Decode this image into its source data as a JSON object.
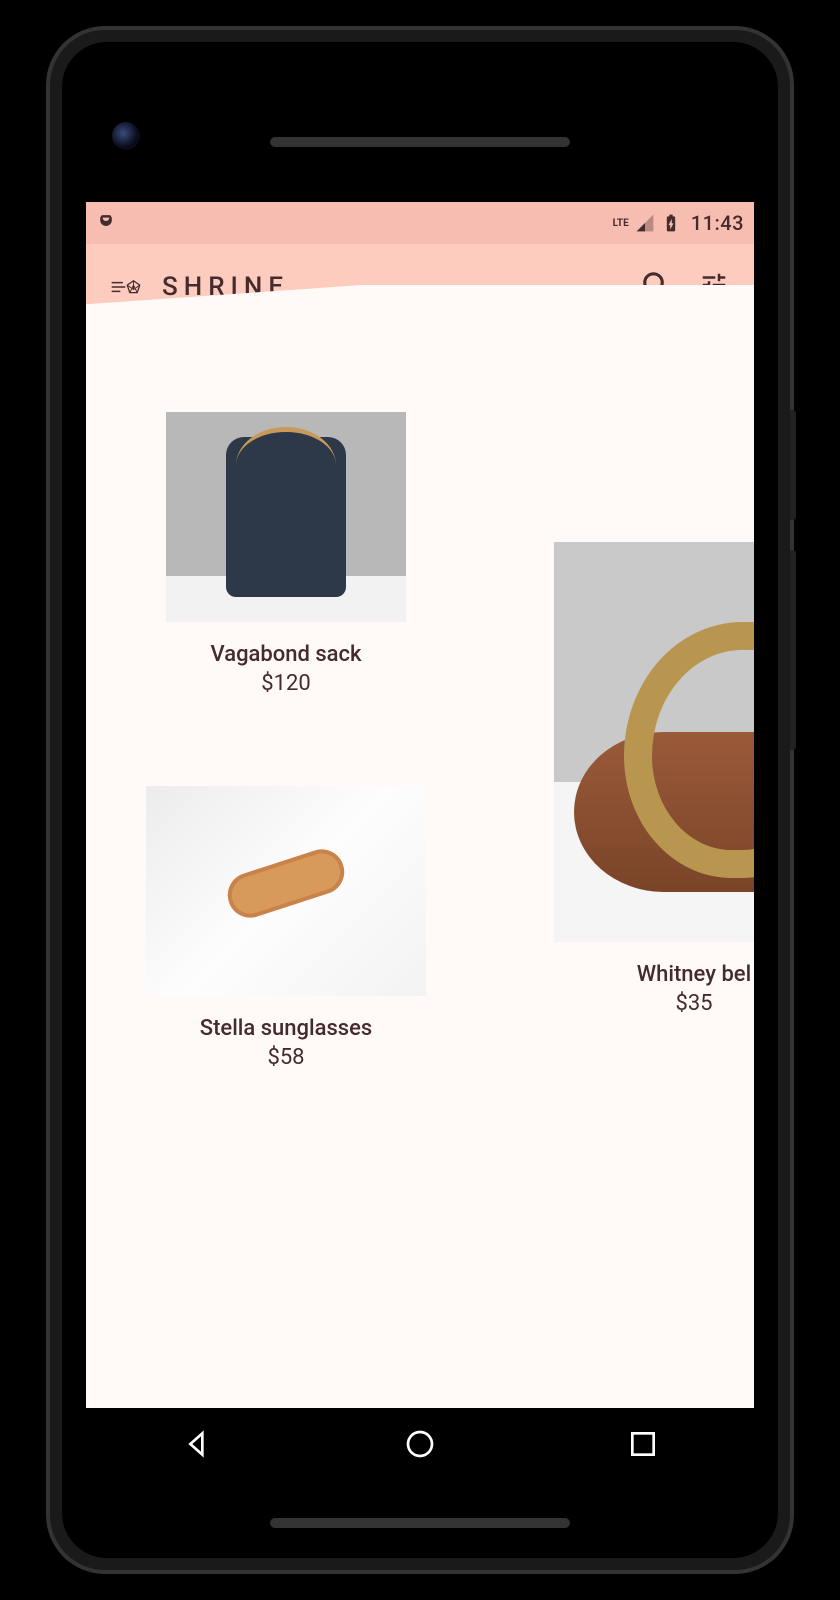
{
  "status_bar": {
    "time": "11:43",
    "network": "LTE"
  },
  "appbar": {
    "title": "SHRINE"
  },
  "products": {
    "left": [
      {
        "name": "Vagabond sack",
        "price": "$120"
      },
      {
        "name": "Stella sunglasses",
        "price": "$58"
      }
    ],
    "right": [
      {
        "name": "Whitney bel",
        "price": "$35"
      }
    ]
  }
}
